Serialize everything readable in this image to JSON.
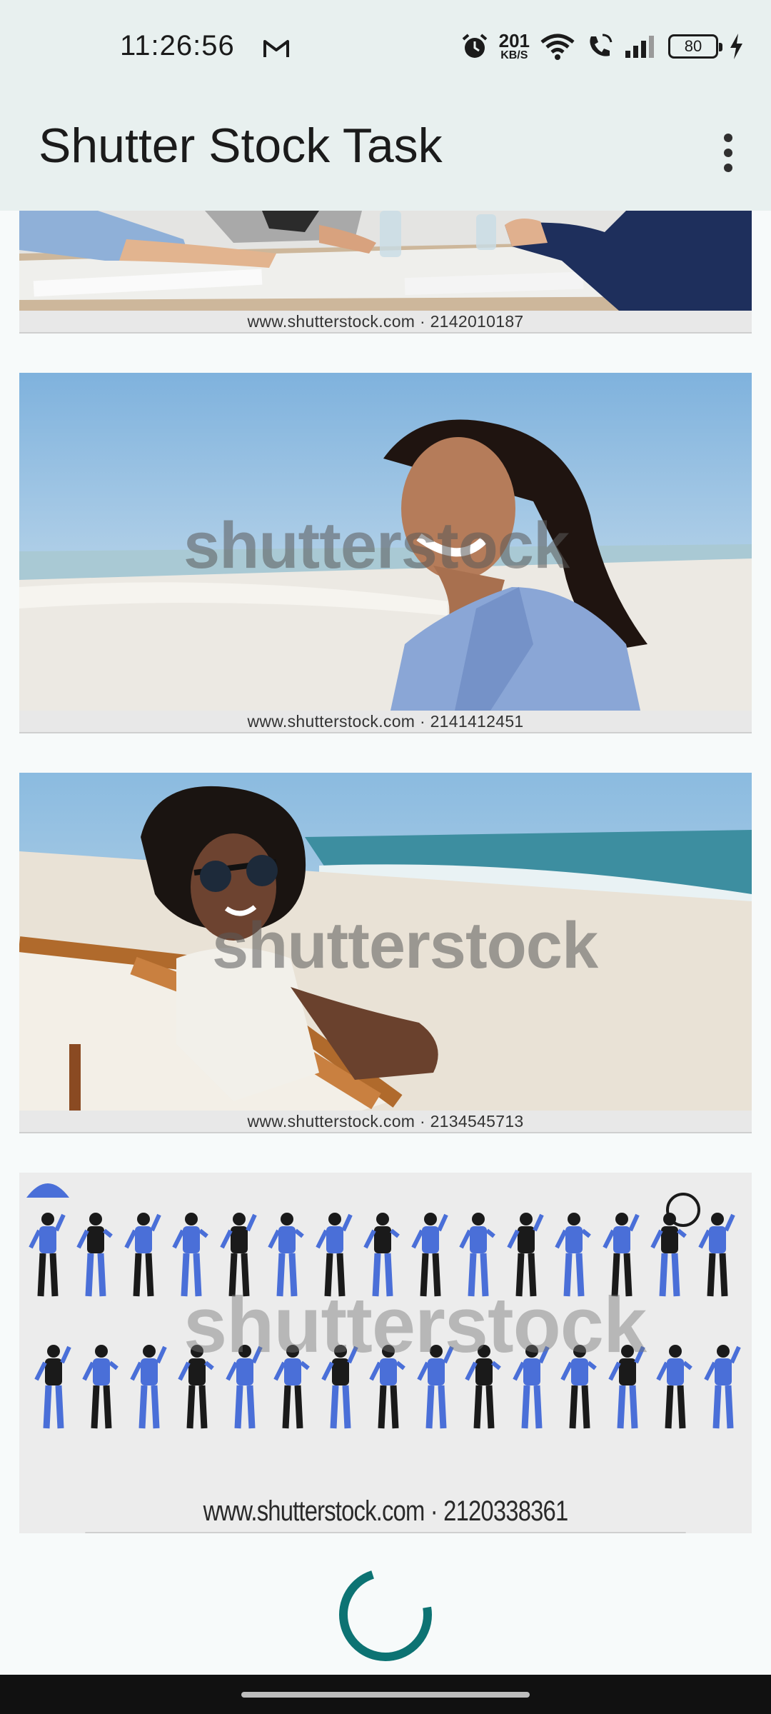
{
  "status_bar": {
    "time": "11:26:56",
    "net_speed_value": "201",
    "net_speed_unit": "KB/S",
    "battery_level": "80",
    "icons": [
      "gmail-icon",
      "alarm-icon",
      "wifi-icon",
      "wifi-call-icon",
      "signal-icon",
      "battery-icon",
      "charging-icon"
    ]
  },
  "app_bar": {
    "title": "Shutter Stock Task",
    "menu_icon": "more-vert-icon"
  },
  "images": [
    {
      "caption": "www.shutterstock.com · 2142010187",
      "subject": "business meeting"
    },
    {
      "caption": "www.shutterstock.com · 2141412451",
      "subject": "woman smiling at beach",
      "watermark": "shutterstock"
    },
    {
      "caption": "www.shutterstock.com · 2134545713",
      "subject": "woman in deck chair at beach",
      "watermark": "shutterstock"
    },
    {
      "caption": "www.shutterstock.com · 2120338361",
      "subject": "people illustrations set",
      "watermark": "shutterstock"
    }
  ],
  "loading": true,
  "colors": {
    "app_bar_bg": "#e8f0ef",
    "spinner": "#0d7373",
    "accent_blue": "#4a6fd8"
  }
}
